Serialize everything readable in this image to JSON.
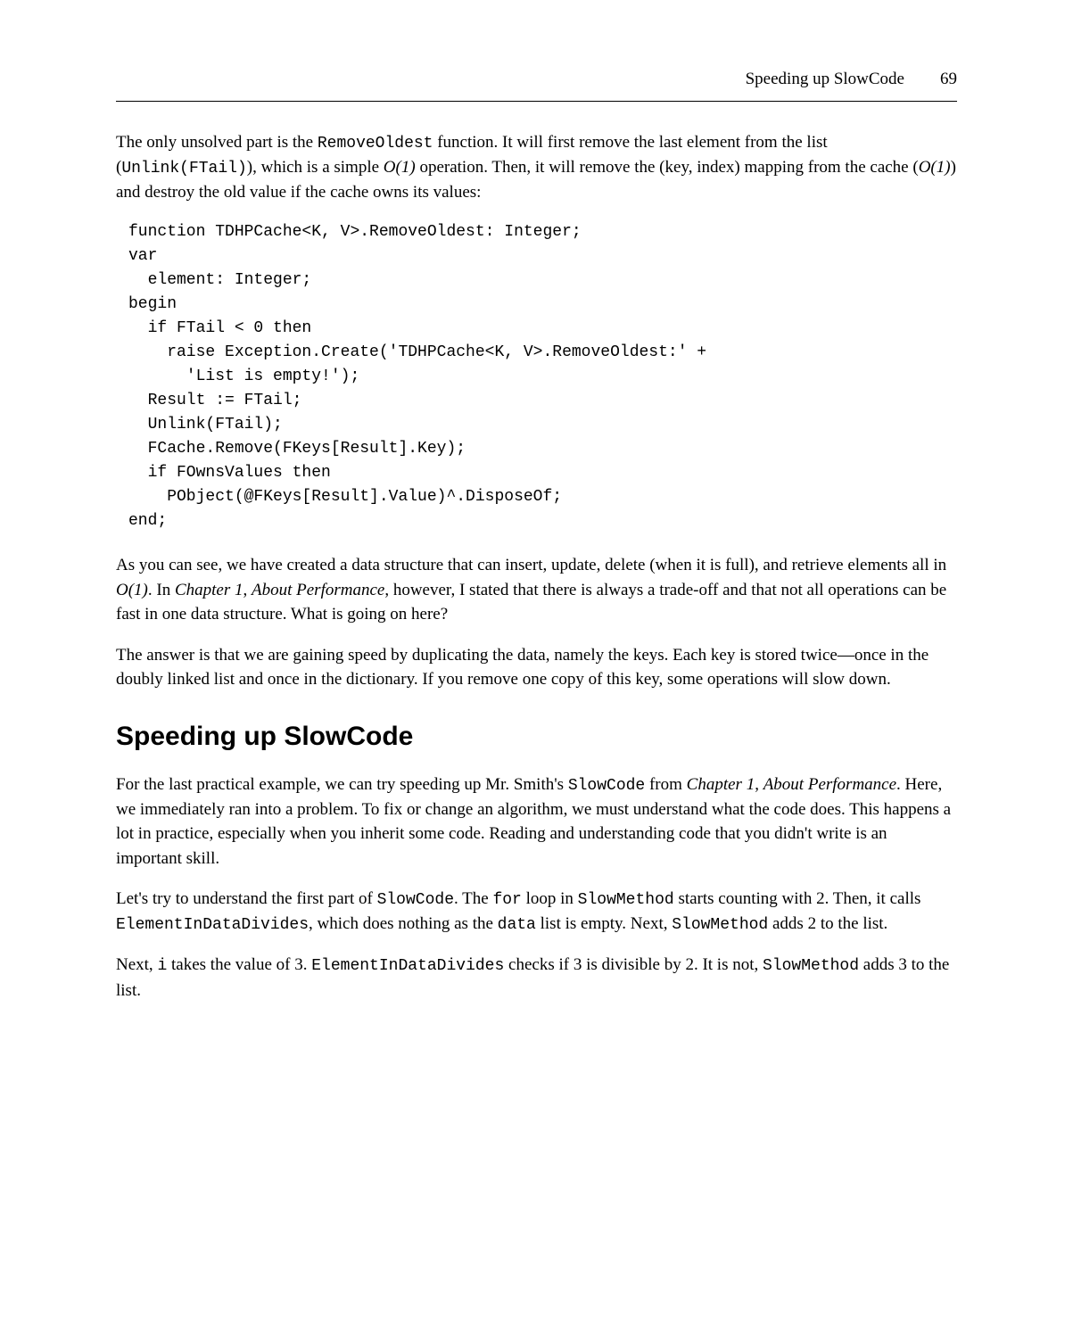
{
  "header": {
    "running_title": "Speeding up SlowCode",
    "page_number": "69"
  },
  "para1": {
    "t1": "The only unsolved part is the ",
    "c1": "RemoveOldest",
    "t2": " function. It will first remove the last element from the list (",
    "c2": "Unlink(FTail)",
    "t3": "), which is a simple ",
    "i1": "O(1)",
    "t4": " operation. Then, it will remove the (key, index) mapping from the cache (",
    "i2": "O(1)",
    "t5": ") and destroy the old value if the cache owns its values:"
  },
  "code1": "function TDHPCache<K, V>.RemoveOldest: Integer;\nvar\n  element: Integer;\nbegin\n  if FTail < 0 then\n    raise Exception.Create('TDHPCache<K, V>.RemoveOldest:' +\n      'List is empty!');\n  Result := FTail;\n  Unlink(FTail);\n  FCache.Remove(FKeys[Result].Key);\n  if FOwnsValues then\n    PObject(@FKeys[Result].Value)^.DisposeOf;\nend;",
  "para2": {
    "t1": "As you can see, we have created a data structure that can insert, update, delete (when it is full), and retrieve elements all in ",
    "i1": "O(1)",
    "t2": ". In ",
    "i2": "Chapter 1",
    "t3": ", ",
    "i3": "About Performance",
    "t4": ", however, I stated that there is always a trade-off and that not all operations can be fast in one data structure. What is going on here?"
  },
  "para3": "The answer is that we are gaining speed by duplicating the data, namely the keys. Each key is stored twice—once in the doubly linked list and once in the dictionary. If you remove one copy of this key, some operations will slow down.",
  "section_heading": "Speeding up SlowCode",
  "para4": {
    "t1": "For the last practical example, we can try speeding up Mr. Smith's ",
    "c1": "SlowCode",
    "t2": " from ",
    "i1": "Chapter 1",
    "t3": ", ",
    "i2": "About Performance",
    "t4": ". Here, we immediately ran into a problem. To fix or change an algorithm, we must understand what the code does. This happens a lot in practice, especially when you inherit some code. Reading and understanding code that you didn't write is an important skill."
  },
  "para5": {
    "t1": "Let's try to understand the first part of ",
    "c1": "SlowCode",
    "t2": ". The ",
    "c2": "for",
    "t3": " loop in ",
    "c3": "SlowMethod",
    "t4": " starts counting with 2. Then, it calls ",
    "c4": "ElementInDataDivides",
    "t5": ", which does nothing as the ",
    "c5": "data",
    "t6": " list is empty. Next, ",
    "c6": "SlowMethod",
    "t7": " adds 2 to the list."
  },
  "para6": {
    "t1": "Next, ",
    "c1": "i",
    "t2": " takes the value of 3. ",
    "c2": "ElementInDataDivides",
    "t3": " checks if 3 is divisible by 2. It is not, ",
    "c3": "SlowMethod",
    "t4": " adds 3 to the list."
  }
}
